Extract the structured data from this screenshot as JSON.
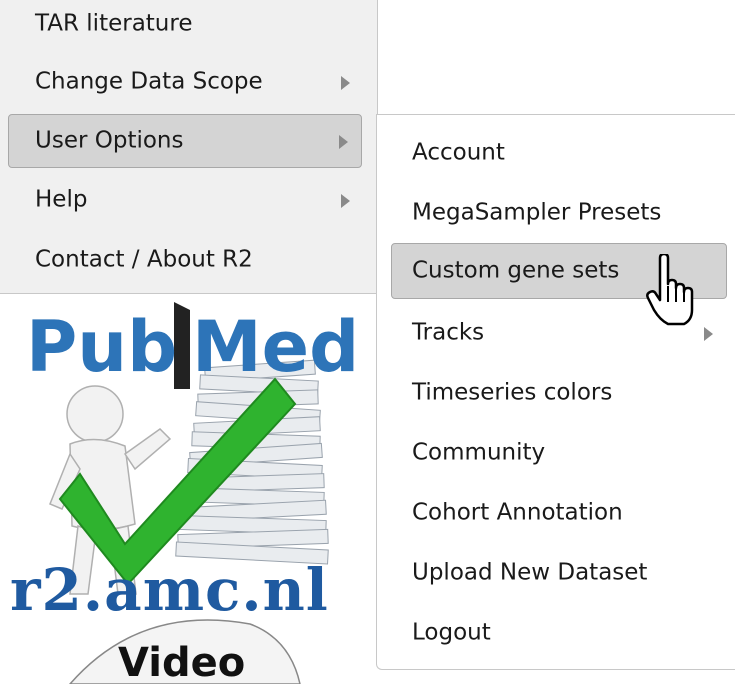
{
  "main_menu": {
    "items": [
      {
        "label": "TAR literature",
        "has_submenu": false
      },
      {
        "label": "Change Data Scope",
        "has_submenu": true
      },
      {
        "label": "User Options",
        "has_submenu": true,
        "highlighted": true
      },
      {
        "label": "Help",
        "has_submenu": true
      },
      {
        "label": "Contact / About R2",
        "has_submenu": false
      }
    ]
  },
  "sub_menu": {
    "items": [
      {
        "label": "Account"
      },
      {
        "label": "MegaSampler Presets"
      },
      {
        "label": "Custom gene sets",
        "highlighted": true
      },
      {
        "label": "Tracks",
        "has_submenu": true
      },
      {
        "label": "Timeseries colors"
      },
      {
        "label": "Community"
      },
      {
        "label": "Cohort Annotation"
      },
      {
        "label": "Upload New Dataset"
      },
      {
        "label": "Logout"
      }
    ]
  },
  "logos": {
    "pubmed_pub": "Pub",
    "pubmed_med": "Med",
    "r2_site": "r2.amc.nl",
    "video": "Video"
  },
  "colors": {
    "menu_bg": "#f0f0f0",
    "highlight_bg": "#d4d4d4",
    "pubmed_blue": "#2d74b8",
    "check_green": "#2fb32f"
  }
}
